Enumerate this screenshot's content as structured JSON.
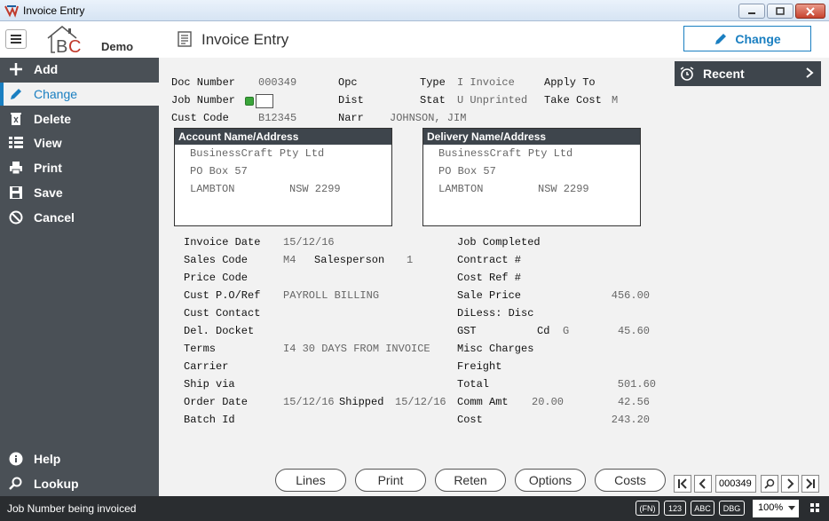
{
  "window": {
    "title": "Invoice Entry"
  },
  "header": {
    "demo_label": "Demo",
    "page_title": "Invoice Entry",
    "change_button": "Change"
  },
  "sidebar": {
    "items": [
      {
        "label": "Add",
        "icon": "plus-icon"
      },
      {
        "label": "Change",
        "icon": "pencil-icon"
      },
      {
        "label": "Delete",
        "icon": "trash-icon"
      },
      {
        "label": "View",
        "icon": "list-icon"
      },
      {
        "label": "Print",
        "icon": "printer-icon"
      },
      {
        "label": "Save",
        "icon": "floppy-icon"
      },
      {
        "label": "Cancel",
        "icon": "cancel-icon"
      }
    ],
    "bottom": [
      {
        "label": "Help",
        "icon": "info-icon"
      },
      {
        "label": "Lookup",
        "icon": "search-icon"
      }
    ]
  },
  "form": {
    "doc_number_label": "Doc Number",
    "doc_number": "000349",
    "opc_label": "Opc",
    "type_label": "Type",
    "type_value": "I Invoice",
    "apply_to_label": "Apply To",
    "job_number_label": "Job Number",
    "dist_label": "Dist",
    "stat_label": "Stat",
    "stat_value": "U Unprinted",
    "take_cost_label": "Take Cost",
    "take_cost_value": "M",
    "cust_code_label": "Cust Code",
    "cust_code": "B12345",
    "narr_label": "Narr",
    "narr_value": "JOHNSON, JIM"
  },
  "account": {
    "heading": "Account Name/Address",
    "line1": "BusinessCraft Pty Ltd",
    "line2": "PO Box 57",
    "city": "LAMBTON",
    "state_post": "NSW 2299"
  },
  "delivery": {
    "heading": "Delivery Name/Address",
    "line1": "BusinessCraft Pty Ltd",
    "line2": "PO Box 57",
    "city": "LAMBTON",
    "state_post": "NSW 2299"
  },
  "left_fields": {
    "invoice_date_label": "Invoice Date",
    "invoice_date": "15/12/16",
    "sales_code_label": "Sales Code",
    "sales_code": "M4",
    "salesperson_label": "Salesperson",
    "salesperson": "1",
    "price_code_label": "Price Code",
    "cust_po_label": "Cust P.O/Ref",
    "cust_po": "PAYROLL BILLING",
    "cust_contact_label": "Cust Contact",
    "del_docket_label": "Del. Docket",
    "terms_label": "Terms",
    "terms": "I4 30 DAYS FROM INVOICE",
    "carrier_label": "Carrier",
    "ship_via_label": "Ship via",
    "order_date_label": "Order Date",
    "order_date": "15/12/16",
    "shipped_label": "Shipped",
    "shipped_date": "15/12/16",
    "batch_id_label": "Batch Id"
  },
  "right_fields": {
    "job_completed_label": "Job Completed",
    "contract_label": "Contract #",
    "cost_ref_label": "Cost Ref #",
    "sale_price_label": "Sale Price",
    "sale_price": "456.00",
    "diless_label": "DiLess: Disc",
    "gst_label": "GST",
    "cd_label": "Cd",
    "cd_value": "G",
    "gst_value": "45.60",
    "misc_label": "Misc Charges",
    "freight_label": "Freight",
    "total_label": "Total",
    "total_value": "501.60",
    "comm_label": "Comm Amt",
    "comm_rate": "20.00",
    "comm_value": "42.56",
    "cost_label": "Cost",
    "cost_value": "243.20"
  },
  "recent": {
    "label": "Recent"
  },
  "buttons": {
    "lines": "Lines",
    "print": "Print",
    "reten": "Reten",
    "options": "Options",
    "costs": "Costs"
  },
  "nav": {
    "record": "000349"
  },
  "status": {
    "message": "Job Number being invoiced",
    "fn": "(FN)",
    "num": "123",
    "abc": "ABC",
    "dbg": "DBG",
    "zoom": "100%"
  },
  "colors": {
    "accent": "#1a7fc1",
    "sidebar": "#4a5056",
    "checkbox": "#3aa53a"
  }
}
